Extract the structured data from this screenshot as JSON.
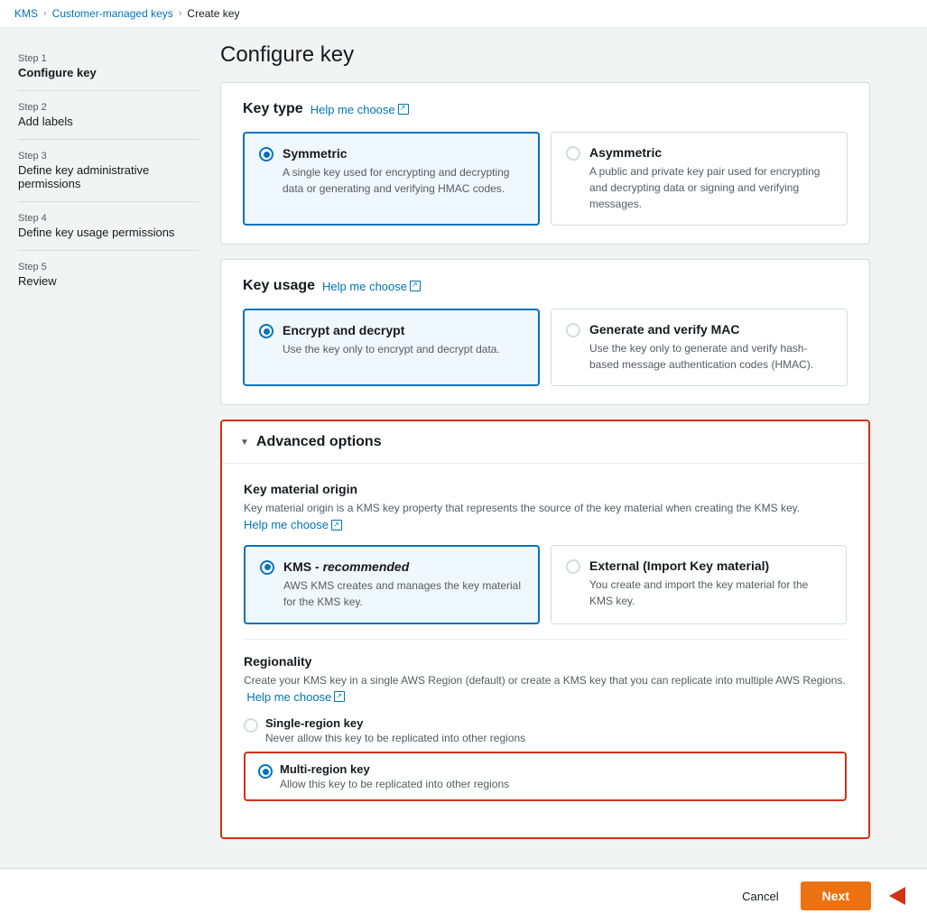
{
  "breadcrumb": {
    "kms": "KMS",
    "customer_managed_keys": "Customer-managed keys",
    "current": "Create key"
  },
  "sidebar": {
    "steps": [
      {
        "step": "Step 1",
        "title": "Configure key",
        "active": true
      },
      {
        "step": "Step 2",
        "title": "Add labels",
        "active": false
      },
      {
        "step": "Step 3",
        "title": "Define key administrative permissions",
        "active": false
      },
      {
        "step": "Step 4",
        "title": "Define key usage permissions",
        "active": false
      },
      {
        "step": "Step 5",
        "title": "Review",
        "active": false
      }
    ]
  },
  "page": {
    "title": "Configure key"
  },
  "key_type": {
    "section_title": "Key type",
    "help_text": "Help me choose",
    "options": [
      {
        "id": "symmetric",
        "title": "Symmetric",
        "description": "A single key used for encrypting and decrypting data or generating and verifying HMAC codes.",
        "selected": true
      },
      {
        "id": "asymmetric",
        "title": "Asymmetric",
        "description": "A public and private key pair used for encrypting and decrypting data or signing and verifying messages.",
        "selected": false
      }
    ]
  },
  "key_usage": {
    "section_title": "Key usage",
    "help_text": "Help me choose",
    "options": [
      {
        "id": "encrypt_decrypt",
        "title": "Encrypt and decrypt",
        "description": "Use the key only to encrypt and decrypt data.",
        "selected": true
      },
      {
        "id": "generate_verify_mac",
        "title": "Generate and verify MAC",
        "description": "Use the key only to generate and verify hash-based message authentication codes (HMAC).",
        "selected": false
      }
    ]
  },
  "advanced_options": {
    "title": "Advanced options",
    "key_material_origin": {
      "title": "Key material origin",
      "description": "Key material origin is a KMS key property that represents the source of the key material when creating the KMS key.",
      "help_text": "Help me choose",
      "options": [
        {
          "id": "kms",
          "title": "KMS - recommended",
          "title_italic": "recommended",
          "description": "AWS KMS creates and manages the key material for the KMS key.",
          "selected": true
        },
        {
          "id": "external",
          "title": "External (Import Key material)",
          "description": "You create and import the key material for the KMS key.",
          "selected": false
        }
      ]
    },
    "regionality": {
      "title": "Regionality",
      "description": "Create your KMS key in a single AWS Region (default) or create a KMS key that you can replicate into multiple AWS Regions.",
      "help_text": "Help me choose",
      "options": [
        {
          "id": "single_region",
          "title": "Single-region key",
          "description": "Never allow this key to be replicated into other regions",
          "selected": false
        },
        {
          "id": "multi_region",
          "title": "Multi-region key",
          "description": "Allow this key to be replicated into other regions",
          "selected": true
        }
      ]
    }
  },
  "buttons": {
    "cancel": "Cancel",
    "next": "Next"
  }
}
